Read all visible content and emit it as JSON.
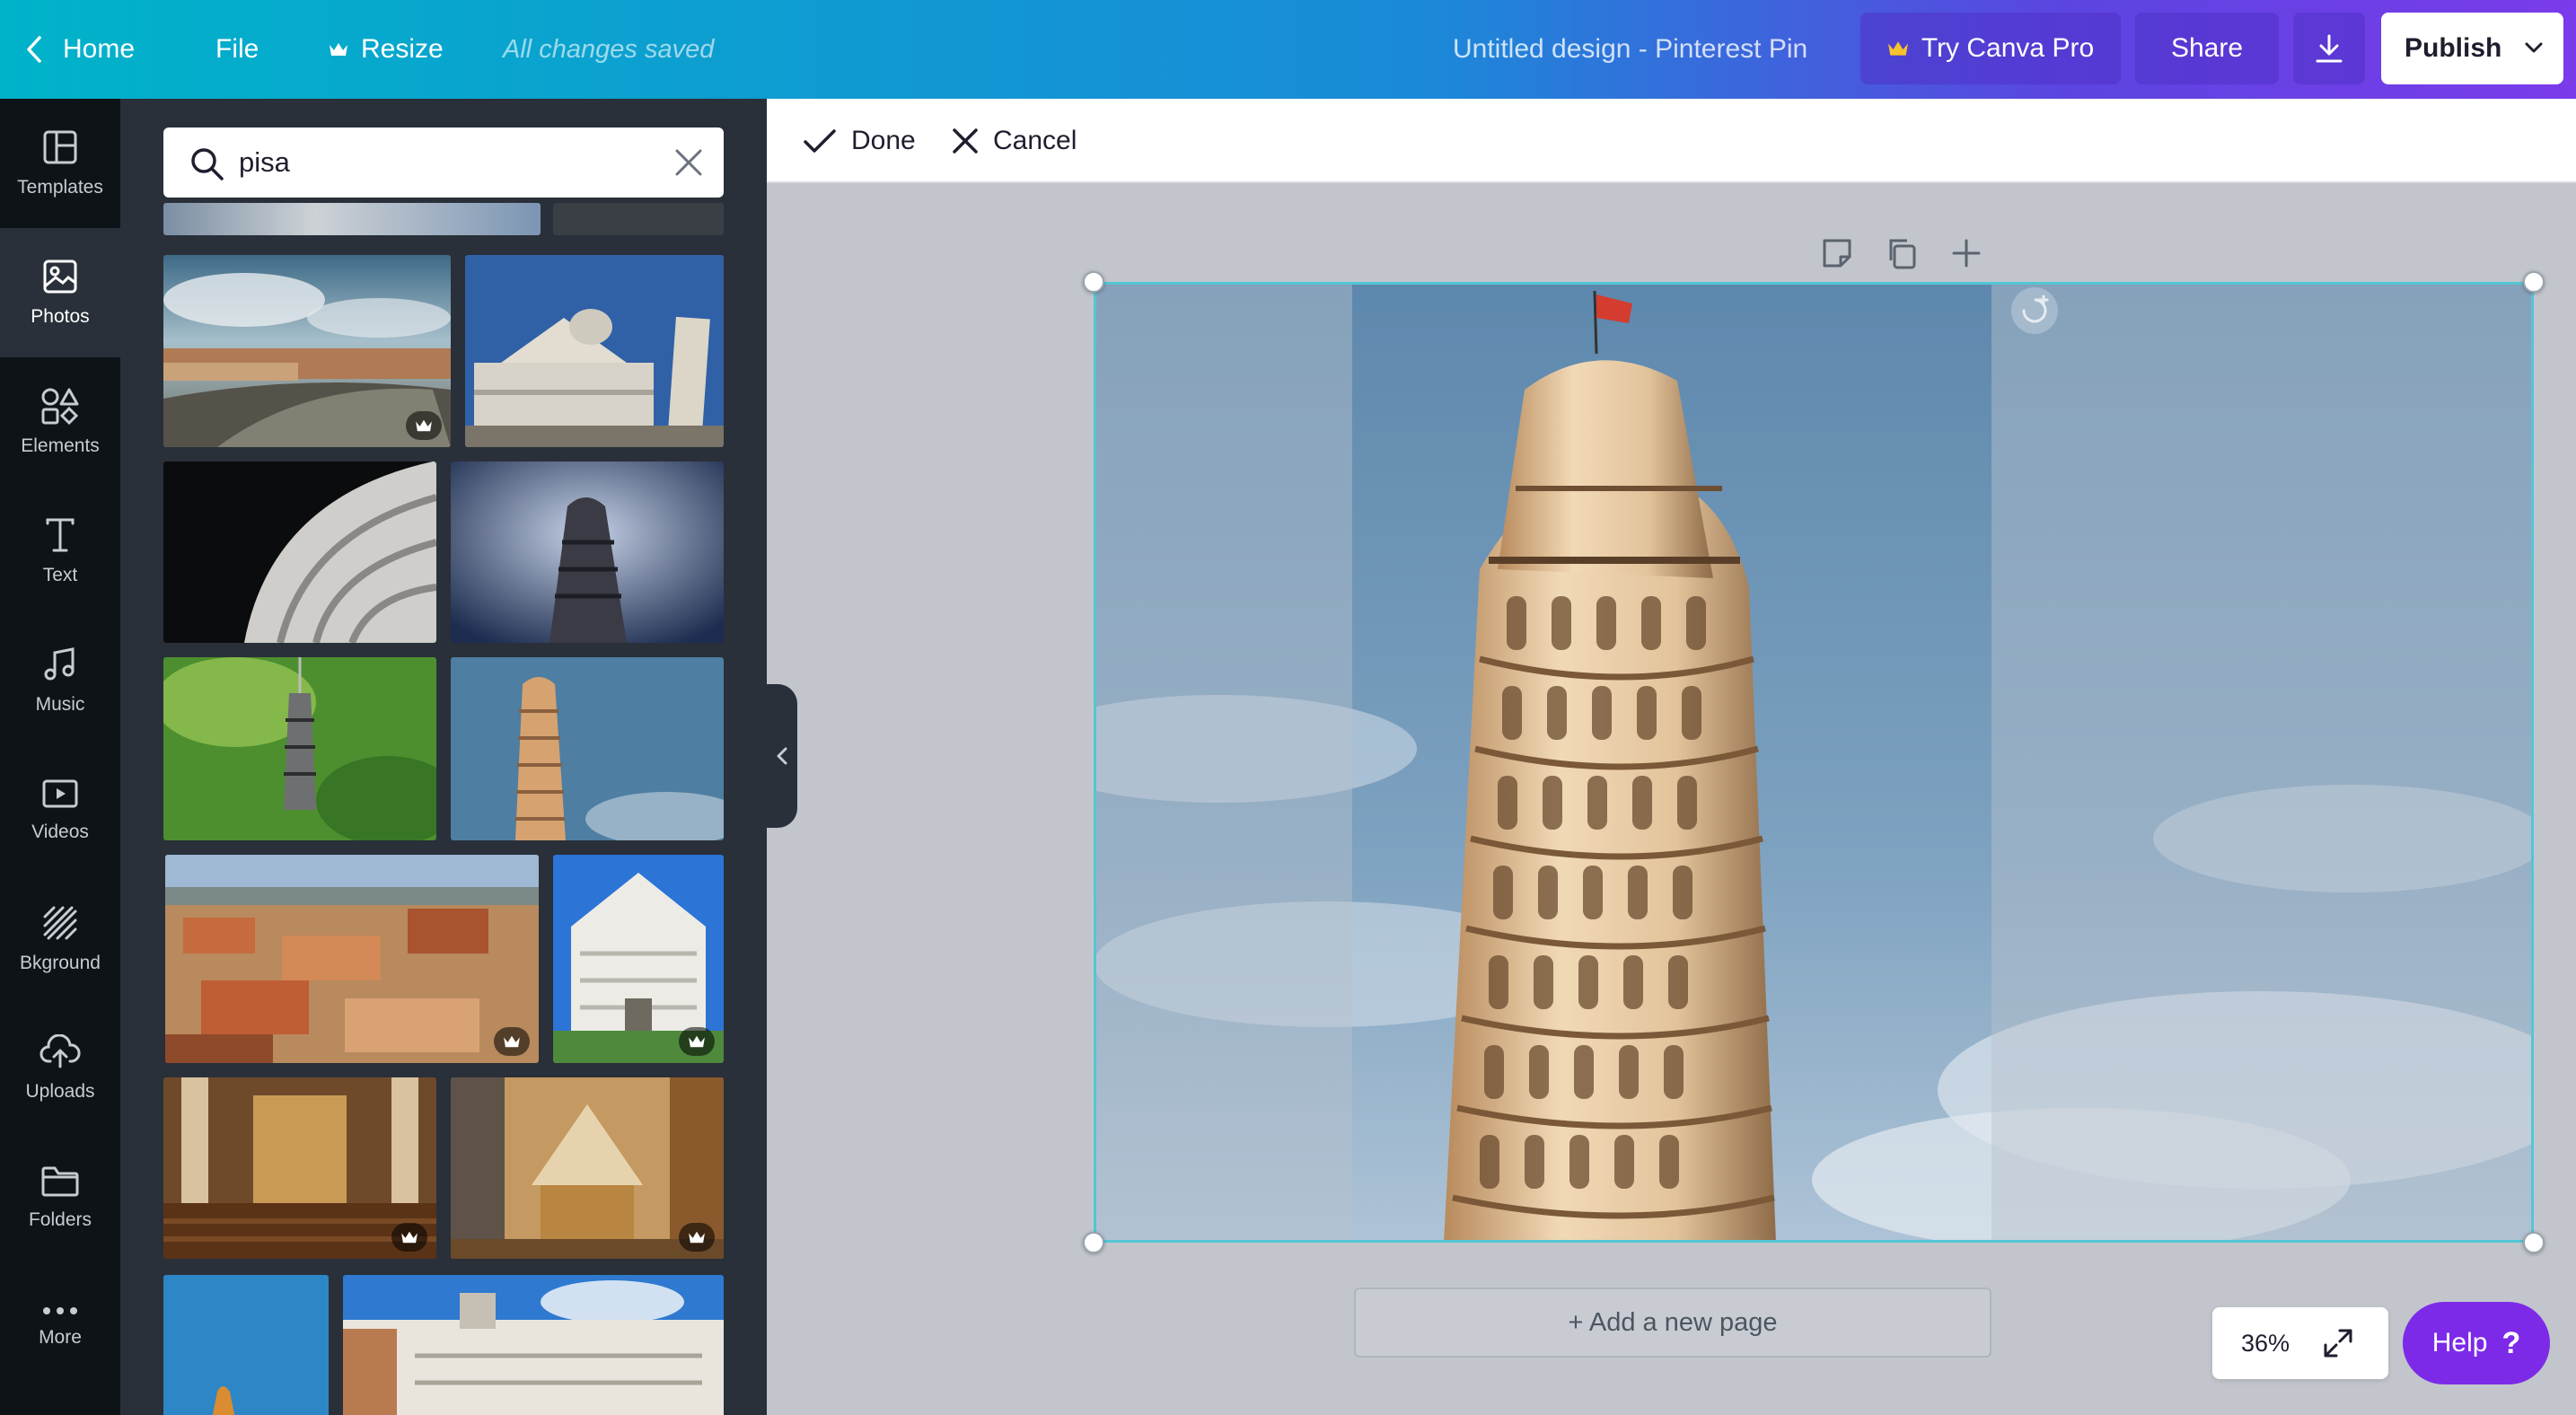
{
  "topbar": {
    "home_label": "Home",
    "file_label": "File",
    "resize_label": "Resize",
    "save_status": "All changes saved",
    "design_title": "Untitled design - Pinterest Pin",
    "try_pro_label": "Try Canva Pro",
    "share_label": "Share",
    "publish_label": "Publish"
  },
  "rail": {
    "items": [
      {
        "label": "Templates",
        "icon": "templates-icon"
      },
      {
        "label": "Photos",
        "icon": "photos-icon"
      },
      {
        "label": "Elements",
        "icon": "elements-icon"
      },
      {
        "label": "Text",
        "icon": "text-icon"
      },
      {
        "label": "Music",
        "icon": "music-icon"
      },
      {
        "label": "Videos",
        "icon": "videos-icon"
      },
      {
        "label": "Bkground",
        "icon": "background-icon"
      },
      {
        "label": "Uploads",
        "icon": "uploads-icon"
      },
      {
        "label": "Folders",
        "icon": "folders-icon"
      },
      {
        "label": "More",
        "icon": "more-icon"
      }
    ],
    "active": "Photos"
  },
  "search": {
    "value": "pisa"
  },
  "results": [
    {
      "subject": "pisa-river-arno",
      "premium": true
    },
    {
      "subject": "pisa-cathedral-tower",
      "premium": false
    },
    {
      "subject": "tower-closeup-dark",
      "premium": false
    },
    {
      "subject": "tower-stormy-sky",
      "premium": false
    },
    {
      "subject": "tower-keychain-grass",
      "premium": false
    },
    {
      "subject": "leaning-tower-blue-sky",
      "premium": false
    },
    {
      "subject": "pisa-rooftops-aerial",
      "premium": true
    },
    {
      "subject": "cathedral-facade",
      "premium": true
    },
    {
      "subject": "cathedral-interior-nave",
      "premium": true
    },
    {
      "subject": "cathedral-interior-altar",
      "premium": true
    },
    {
      "subject": "statue-blue-sky",
      "premium": false
    },
    {
      "subject": "palazzo-building",
      "premium": false
    }
  ],
  "editor": {
    "done_label": "Done",
    "cancel_label": "Cancel",
    "add_page_label": "+ Add a new page",
    "zoom_value": "36%",
    "help_label": "Help",
    "help_symbol": "?"
  },
  "colors": {
    "accent": "#7d2ae8",
    "selection": "#53c6d4",
    "panel": "#293039",
    "rail": "#0e1318"
  }
}
